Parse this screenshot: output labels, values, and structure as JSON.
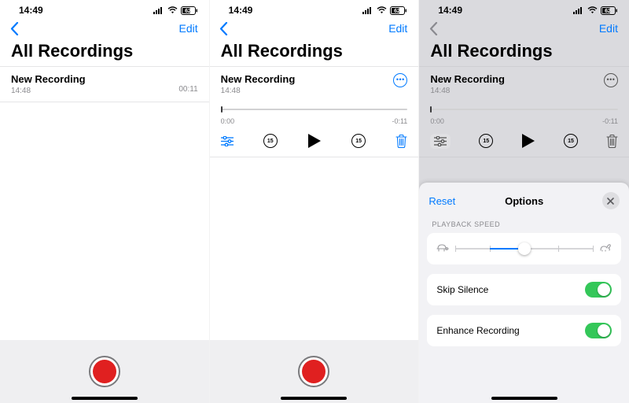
{
  "status": {
    "time": "14:49",
    "battery": "62"
  },
  "nav": {
    "edit": "Edit"
  },
  "title": "All Recordings",
  "recording": {
    "name": "New Recording",
    "timestamp": "14:48",
    "duration": "00:11"
  },
  "scrubber": {
    "current": "0:00",
    "remaining": "-0:11"
  },
  "controls": {
    "skip_back": "15",
    "skip_fwd": "15"
  },
  "sheet": {
    "reset": "Reset",
    "title": "Options",
    "section_speed": "PLAYBACK SPEED",
    "skip_silence": {
      "label": "Skip Silence",
      "on": true
    },
    "enhance": {
      "label": "Enhance Recording",
      "on": true
    },
    "speed_position_pct": 50
  }
}
